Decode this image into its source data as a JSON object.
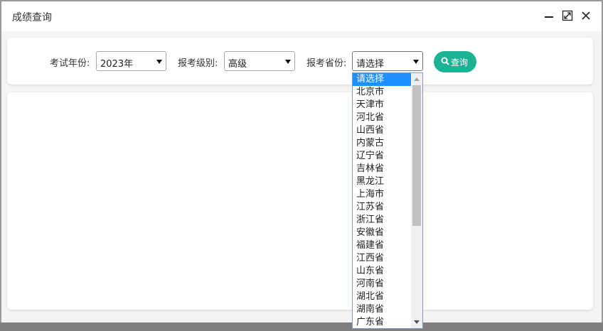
{
  "window": {
    "title": "成绩查询",
    "controls": [
      "minimize-icon",
      "maximize-icon",
      "close-icon"
    ]
  },
  "filters": {
    "year": {
      "label": "考试年份:",
      "value": "2023年"
    },
    "level": {
      "label": "报考级别:",
      "value": "高级"
    },
    "province": {
      "label": "报考省份:",
      "value": "请选择"
    },
    "search_button": {
      "label": "查询",
      "icon": "search-icon",
      "color": "#1bb394"
    }
  },
  "province_dropdown": {
    "open": true,
    "highlight_color": "#1e90ff",
    "options": [
      "请选择",
      "北京市",
      "天津市",
      "河北省",
      "山西省",
      "内蒙古",
      "辽宁省",
      "吉林省",
      "黑龙江",
      "上海市",
      "江苏省",
      "浙江省",
      "安徽省",
      "福建省",
      "江西省",
      "山东省",
      "河南省",
      "湖北省",
      "湖南省",
      "广东省"
    ],
    "selected_index": 0
  }
}
